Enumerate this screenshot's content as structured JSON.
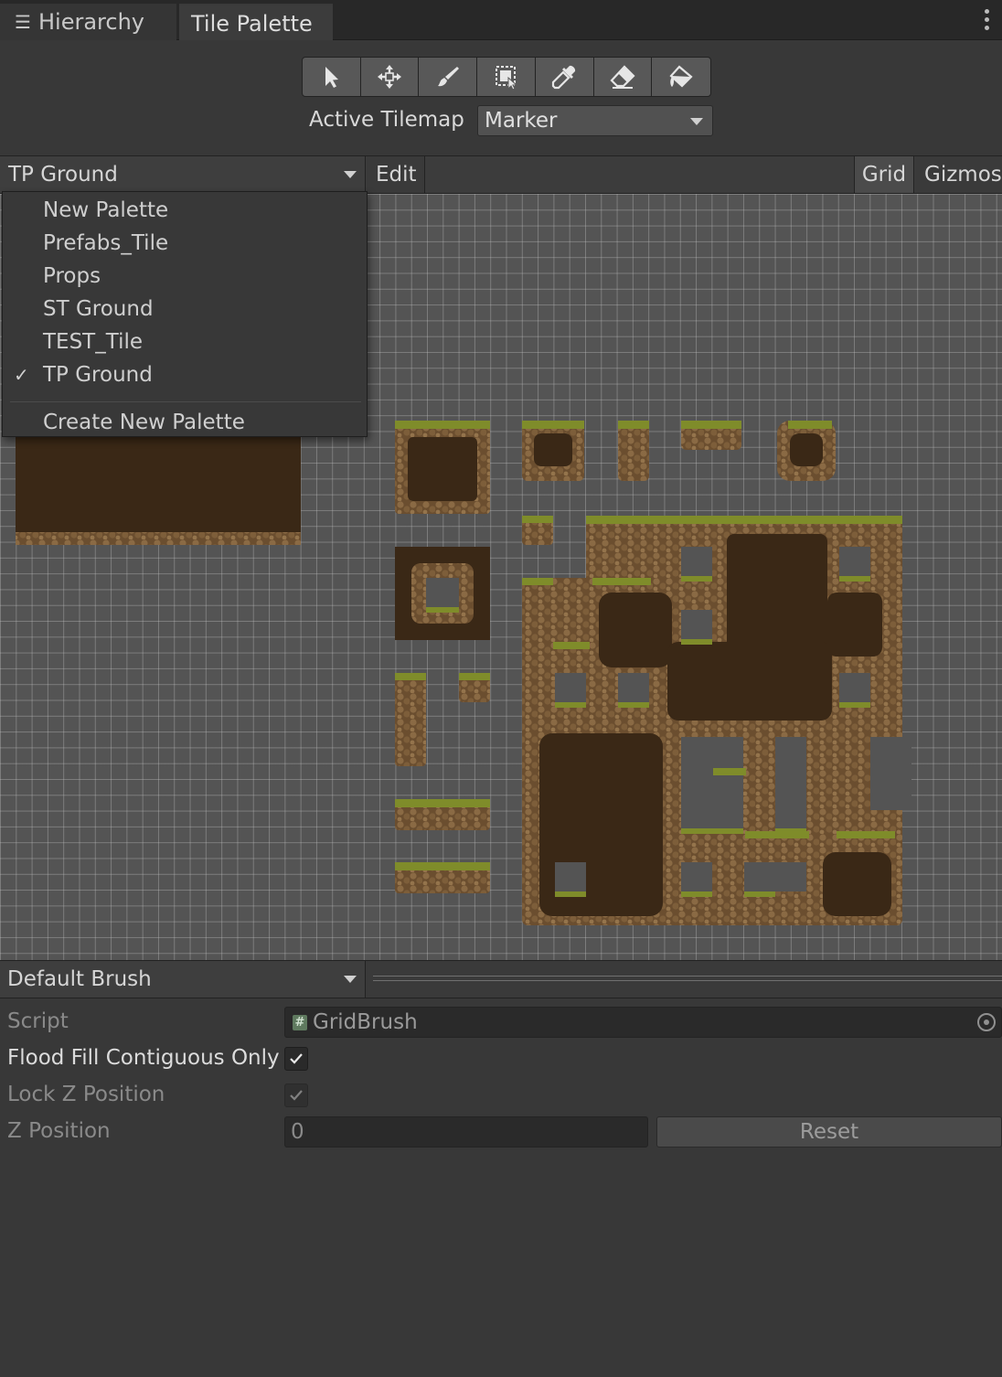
{
  "tabs": [
    {
      "label": "Hierarchy",
      "icon": "hierarchy-list-icon"
    },
    {
      "label": "Tile Palette"
    }
  ],
  "toolbar": {
    "tools": [
      "select-arrow-icon",
      "move-icon",
      "paint-brush-icon",
      "box-fill-icon",
      "picker-icon",
      "eraser-icon",
      "flood-fill-icon"
    ]
  },
  "active_tilemap": {
    "label": "Active Tilemap",
    "value": "Marker"
  },
  "palette_bar": {
    "selected": "TP Ground",
    "edit_label": "Edit",
    "grid_label": "Grid",
    "gizmos_label": "Gizmos"
  },
  "palette_menu": {
    "items": [
      "New Palette",
      "Prefabs_Tile",
      "Props",
      "ST Ground",
      "TEST_Tile",
      "TP Ground"
    ],
    "checked": "TP Ground",
    "create_label": "Create New Palette"
  },
  "brush": {
    "selected": "Default Brush"
  },
  "inspector": {
    "script_label": "Script",
    "script_value": "GridBrush",
    "flood_fill_label": "Flood Fill Contiguous Only",
    "flood_fill_checked": true,
    "lock_z_label": "Lock Z Position",
    "lock_z_checked": true,
    "z_position_label": "Z Position",
    "z_position_value": "0",
    "reset_label": "Reset"
  },
  "colors": {
    "panel": "#383838",
    "grid_bg": "#545454",
    "dirt_dark": "#3a2816",
    "rock": "#7a5c39",
    "grass": "#7f8c2a"
  }
}
